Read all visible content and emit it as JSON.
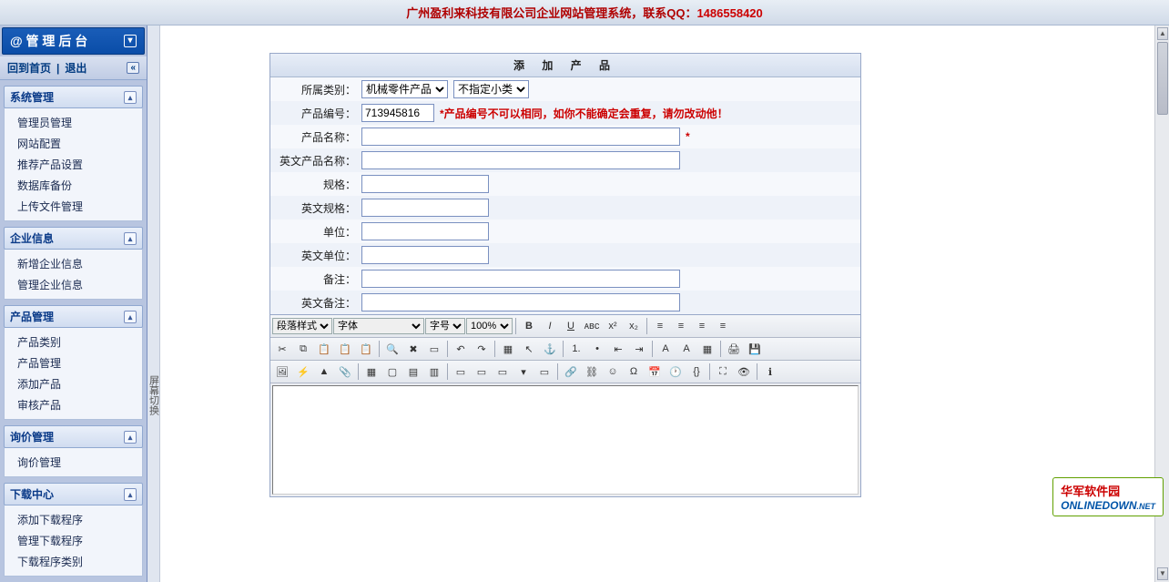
{
  "header": {
    "title_prefix": "广州盈利来科技有限公司企业网站管理系统，联系QQ：",
    "qq": "1486558420"
  },
  "sidebar": {
    "brand": "@ 管 理 后 台",
    "home": "回到首页",
    "logout": "退出",
    "collapse": "«",
    "sections": [
      {
        "title": "系统管理",
        "items": [
          "管理员管理",
          "网站配置",
          "推荐产品设置",
          "数据库备份",
          "上传文件管理"
        ]
      },
      {
        "title": "企业信息",
        "items": [
          "新增企业信息",
          "管理企业信息"
        ]
      },
      {
        "title": "产品管理",
        "items": [
          "产品类别",
          "产品管理",
          "添加产品",
          "审核产品"
        ]
      },
      {
        "title": "询价管理",
        "items": [
          "询价管理"
        ]
      },
      {
        "title": "下载中心",
        "items": [
          "添加下载程序",
          "管理下载程序",
          "下载程序类别"
        ]
      }
    ]
  },
  "side_toggle": "屏幕切换",
  "form": {
    "title": "添 加 产 品",
    "labels": {
      "category": "所属类别：",
      "code": "产品编号：",
      "name": "产品名称：",
      "name_en": "英文产品名称：",
      "spec": "规格：",
      "spec_en": "英文规格：",
      "unit": "单位：",
      "unit_en": "英文单位：",
      "remark": "备注：",
      "remark_en": "英文备注："
    },
    "category_main_sel": "机械零件产品",
    "category_sub_sel": "不指定小类",
    "code_value": "713945816",
    "code_hint": "*产品编号不可以相同，如你不能确定会重复，请勿改动他！",
    "req_mark": "*"
  },
  "editor": {
    "para_label": "段落样式",
    "font_label": "字体",
    "size_label": "字号",
    "zoom_label": "100%"
  },
  "watermark": {
    "cn": "华军软件园",
    "en": "ONLINEDOWN",
    "net": ".NET"
  }
}
